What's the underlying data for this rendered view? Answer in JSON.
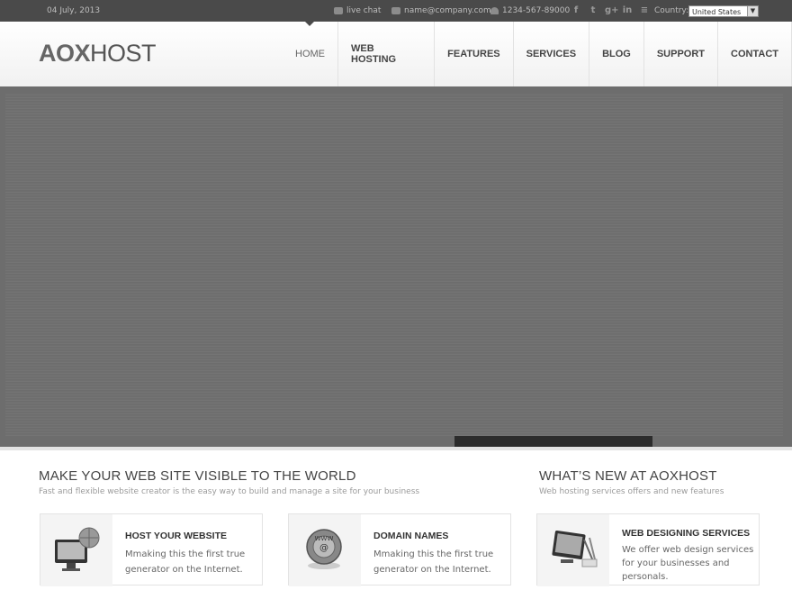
{
  "topbar": {
    "date": "04 July, 2013",
    "live_chat": "live chat",
    "email": "name@company.com",
    "phone": "1234-567-89000",
    "country_label": "Country:",
    "country_value": "United States",
    "social_icons": [
      "facebook-icon",
      "twitter-icon",
      "googleplus-icon",
      "linkedin-icon",
      "rss-icon"
    ]
  },
  "header": {
    "logo_bold": "AOX",
    "logo_light": "HOST",
    "nav": [
      "HOME",
      "WEB HOSTING",
      "FEATURES",
      "SERVICES",
      "BLOG",
      "SUPPORT",
      "CONTACT"
    ]
  },
  "section_left": {
    "title": "MAKE YOUR WEB SITE VISIBLE TO THE WORLD",
    "subtitle": "Fast and flexible website creator is the easy way to build and manage a site for your business"
  },
  "section_right": {
    "title": "WHAT’S NEW AT AOXHOST",
    "subtitle": "Web hosting services offers and new features"
  },
  "cards": [
    {
      "title": "HOST YOUR WEBSITE",
      "text": "Mmaking this the first true generator on the Internet.",
      "icon": "monitor-globe-icon"
    },
    {
      "title": "DOMAIN NAMES",
      "text": "Mmaking this the first true generator on the Internet.",
      "icon": "www-globe-icon"
    },
    {
      "title": "WEB DESIGNING SERVICES",
      "text": "We offer web design services for your businesses and personals.",
      "icon": "design-monitor-icon"
    }
  ]
}
